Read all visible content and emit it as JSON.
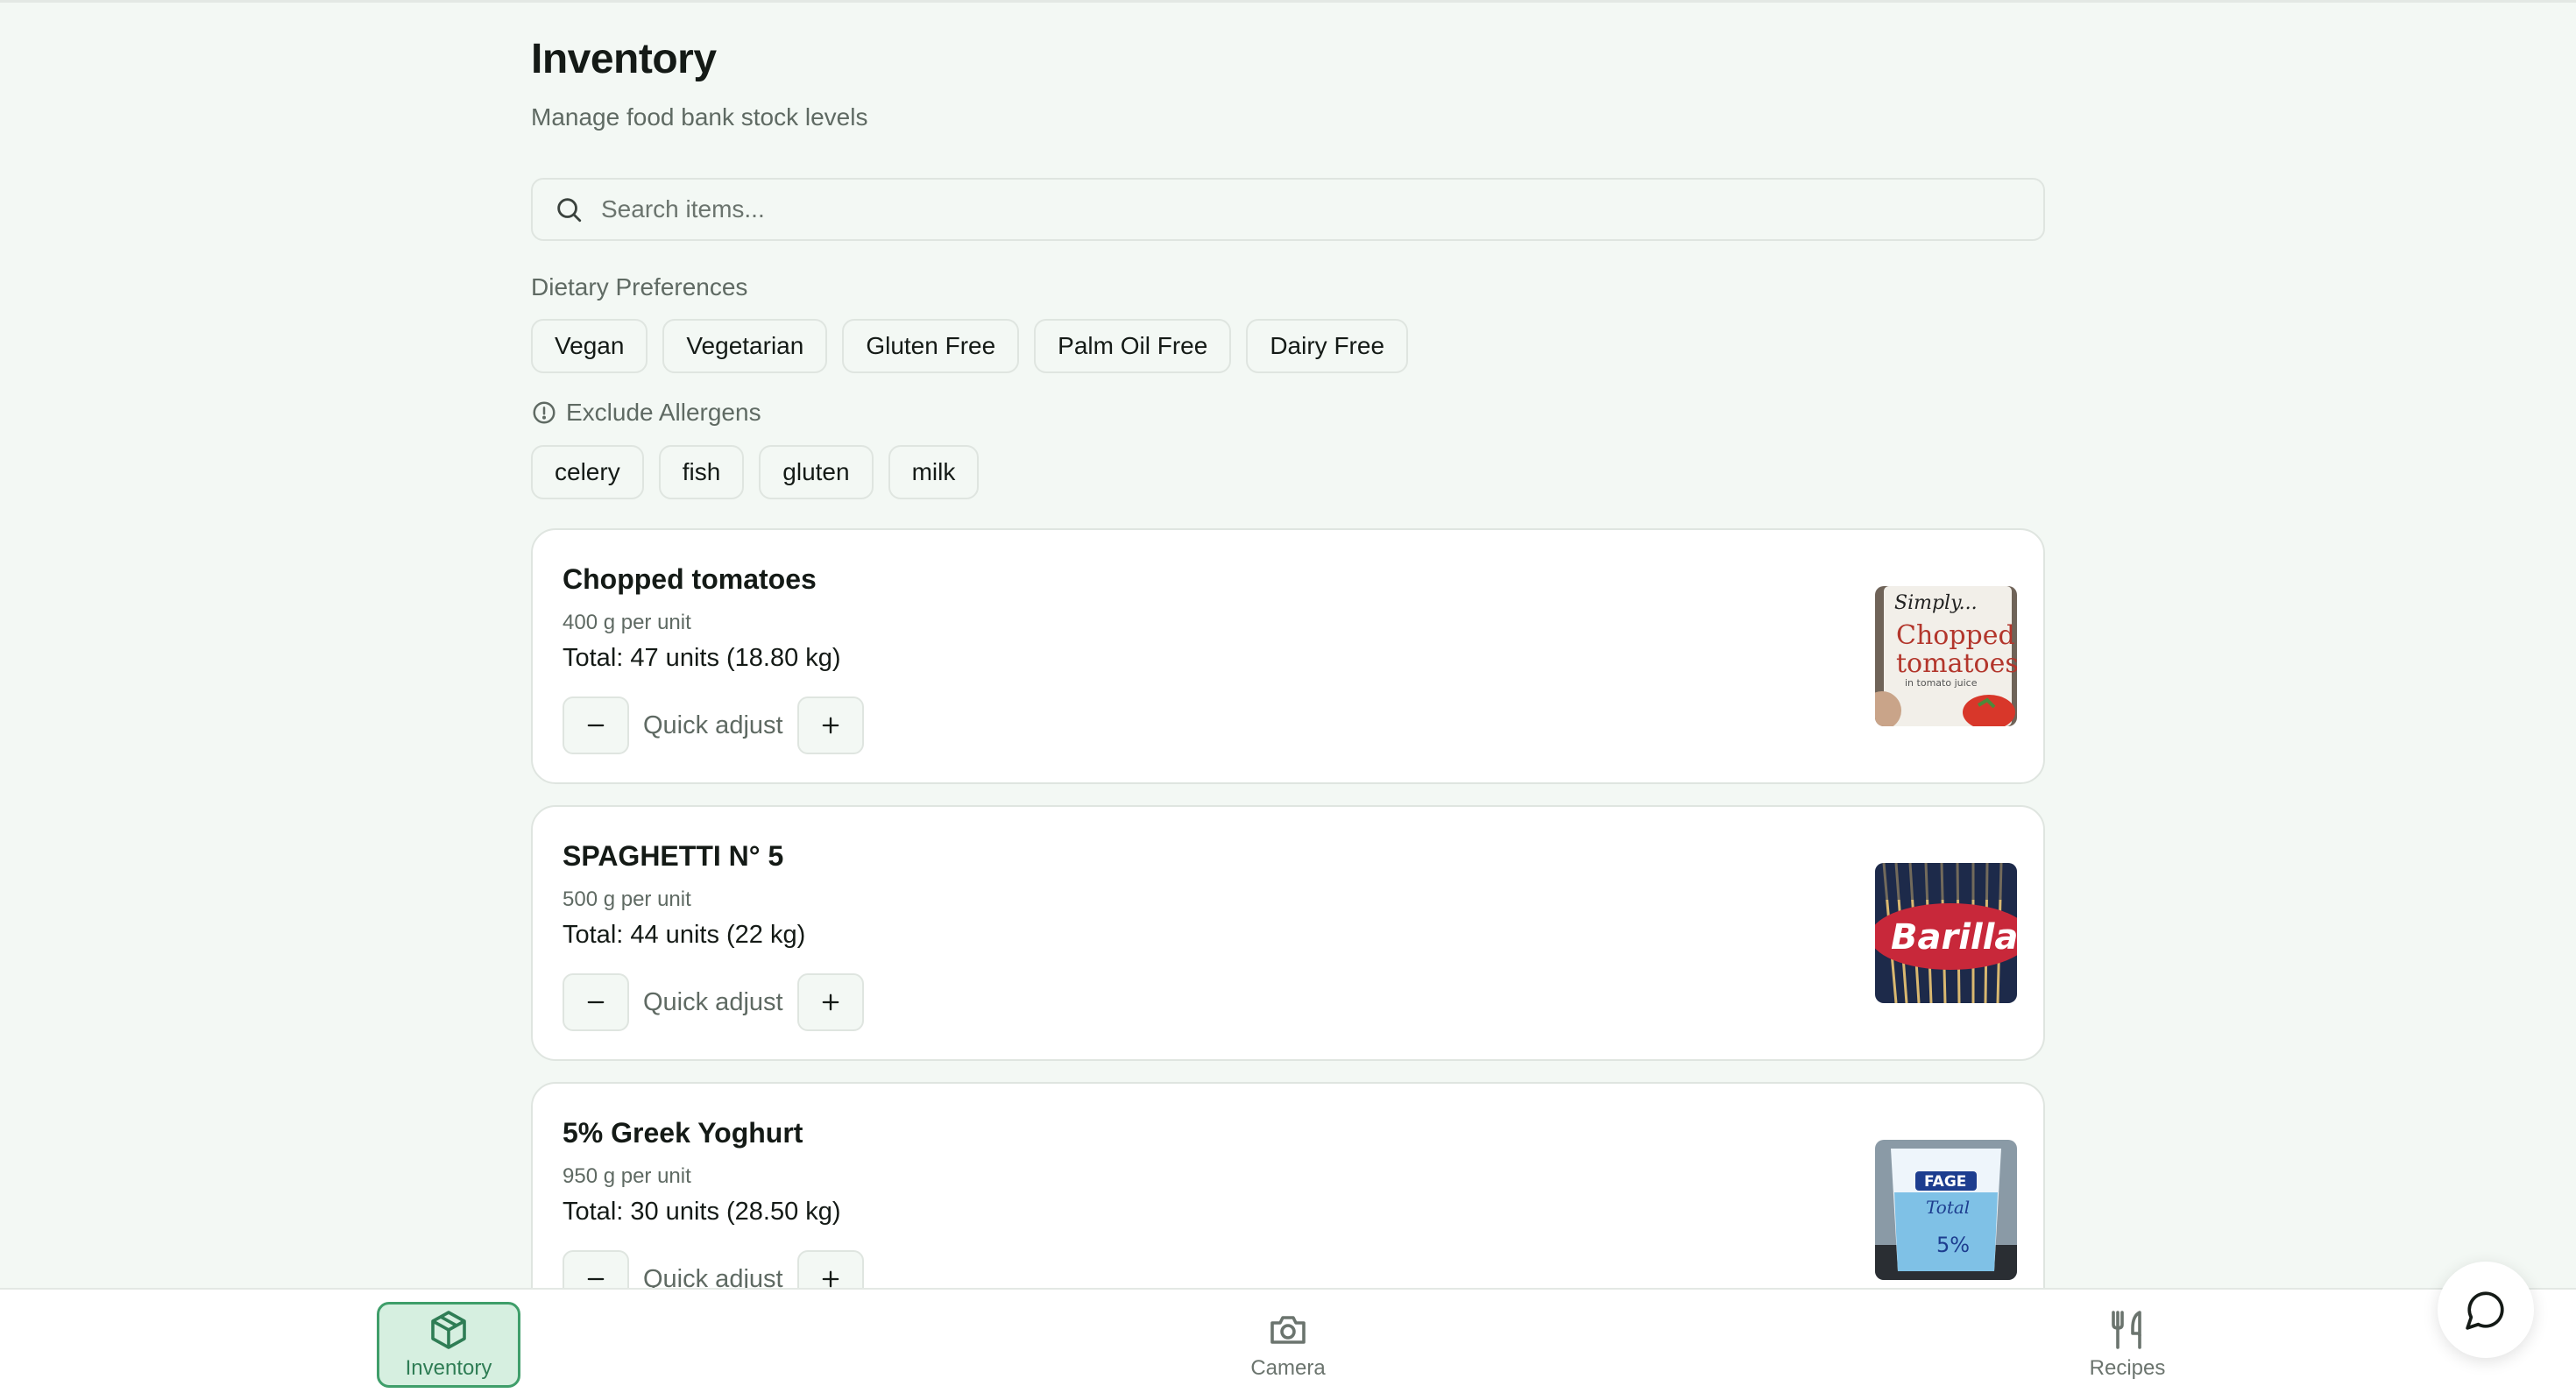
{
  "header": {
    "title": "Inventory",
    "subtitle": "Manage food bank stock levels"
  },
  "search": {
    "placeholder": "Search items...",
    "value": ""
  },
  "dietary": {
    "label": "Dietary Preferences",
    "options": [
      "Vegan",
      "Vegetarian",
      "Gluten Free",
      "Palm Oil Free",
      "Dairy Free"
    ]
  },
  "allergens": {
    "label": "Exclude Allergens",
    "options": [
      "celery",
      "fish",
      "gluten",
      "milk"
    ]
  },
  "items": [
    {
      "name": "Chopped tomatoes",
      "unit": "400 g per unit",
      "total": "Total: 47 units (18.80 kg)",
      "adjust_label": "Quick adjust",
      "image_text": [
        "Simply...",
        "Chopped",
        "tomatoes",
        "in tomato juice"
      ]
    },
    {
      "name": "SPAGHETTI N° 5",
      "unit": "500 g per unit",
      "total": "Total: 44 units (22 kg)",
      "adjust_label": "Quick adjust",
      "image_text": [
        "Barilla"
      ]
    },
    {
      "name": "5% Greek Yoghurt",
      "unit": "950 g per unit",
      "total": "Total: 30 units (28.50 kg)",
      "adjust_label": "Quick adjust",
      "image_text": [
        "FAGE",
        "Total",
        "5%"
      ]
    }
  ],
  "nav": {
    "items": [
      {
        "label": "Inventory",
        "icon": "box-icon",
        "active": true
      },
      {
        "label": "Camera",
        "icon": "camera-icon",
        "active": false
      },
      {
        "label": "Recipes",
        "icon": "utensils-icon",
        "active": false
      }
    ]
  },
  "colors": {
    "background": "#f3f8f4",
    "accent": "#3f9e6a",
    "active_bg": "#d6efe0"
  }
}
